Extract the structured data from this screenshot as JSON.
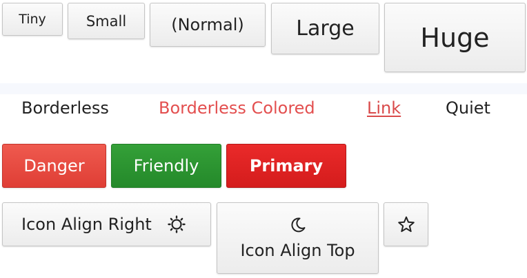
{
  "row_sizes": {
    "tiny": "Tiny",
    "small": "Small",
    "normal": "(Normal)",
    "large": "Large",
    "huge": "Huge"
  },
  "row_styles": {
    "borderless": "Borderless",
    "borderless_colored": "Borderless Colored",
    "link": "Link",
    "quiet": "Quiet"
  },
  "row_intents": {
    "danger": "Danger",
    "friendly": "Friendly",
    "primary": "Primary"
  },
  "row_icons": {
    "icon_align_right": "Icon Align Right",
    "icon_align_right_icon": "sun-icon",
    "icon_align_top": "Icon Align Top",
    "icon_align_top_icon": "moon-icon",
    "icon_only_icon": "star-icon"
  },
  "colors": {
    "danger": "#e24a40",
    "friendly": "#2a922f",
    "primary": "#dc2222",
    "borderless_colored_text": "#e34f4f",
    "link_text": "#d94a4a"
  }
}
